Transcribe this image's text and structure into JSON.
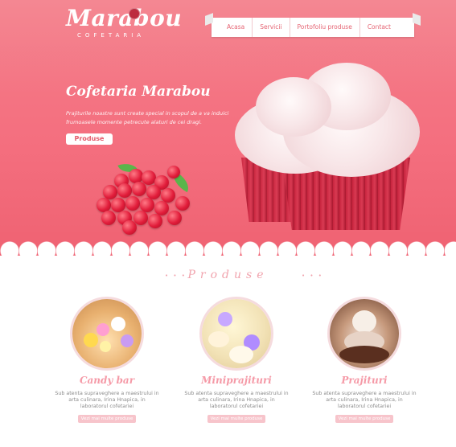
{
  "brand": {
    "logo": "Marabou",
    "tagline": "COFETARIA"
  },
  "nav": {
    "items": [
      "Acasa",
      "Servicii",
      "Portofoliu produse",
      "Contact"
    ]
  },
  "hero": {
    "title": "Cofetaria Marabou",
    "text": "Prajiturile noastre sunt create special in scopul de a va induici frumoasele momente petrecute alaturi de cei dragi.",
    "button": "Produse"
  },
  "section": {
    "title": "Produse",
    "left_deco": "• • •",
    "right_deco": "• • •"
  },
  "products": [
    {
      "title": "Candy bar",
      "text": "Sub atenta supraveghere a maestrului in arta culinara, Irina Hnapica, in laboratorul cofetariei",
      "button": "Vezi mai multe produse"
    },
    {
      "title": "Miniprajituri",
      "text": "Sub atenta supraveghere a maestrului in arta culinara, Irina Hnapica, in laboratorul cofetariei",
      "button": "Vezi mai multe produse"
    },
    {
      "title": "Prajituri",
      "text": "Sub atenta supraveghere a maestrului in arta culinara, Irina Hnapica, in laboratorul cofetariei",
      "button": "Vezi mai multe produse"
    }
  ],
  "colors": {
    "hero": "#f46f7f",
    "accent": "#e45b6b",
    "pink_text": "#f59aa7"
  }
}
